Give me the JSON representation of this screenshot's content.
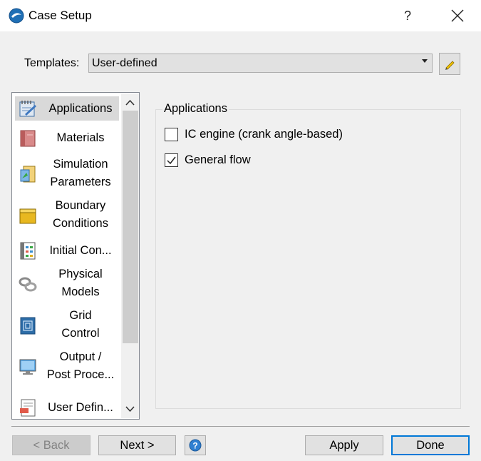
{
  "window": {
    "title": "Case Setup",
    "help_label": "?",
    "icons": {
      "app": "app-logo-icon",
      "close": "close-icon"
    }
  },
  "templates": {
    "label": "Templates:",
    "selected": "User-defined",
    "edit_icon": "pencil-icon"
  },
  "nav": {
    "items": [
      {
        "label": "Applications",
        "icon": "applications-icon",
        "selected": true
      },
      {
        "label": "Materials",
        "icon": "materials-icon"
      },
      {
        "label": "Simulation Parameters",
        "line1": "Simulation",
        "line2": "Parameters",
        "icon": "simulation-parameters-icon"
      },
      {
        "label": "Boundary Conditions",
        "line1": "Boundary",
        "line2": "Conditions",
        "icon": "boundary-conditions-icon"
      },
      {
        "label": "Initial Con...",
        "icon": "initial-conditions-icon"
      },
      {
        "label": "Physical Models",
        "line1": "Physical",
        "line2": "Models",
        "icon": "physical-models-icon"
      },
      {
        "label": "Grid Control",
        "line1": "Grid",
        "line2": "Control",
        "icon": "grid-control-icon"
      },
      {
        "label": "Output / Post Proce...",
        "line1": "Output /",
        "line2": "Post Proce...",
        "icon": "output-icon"
      },
      {
        "label": "User Defin...",
        "icon": "user-defined-icon"
      }
    ]
  },
  "applications": {
    "group_title": "Applications",
    "options": [
      {
        "label": "IC engine (crank angle-based)",
        "checked": false
      },
      {
        "label": "General flow",
        "checked": true
      }
    ]
  },
  "footer": {
    "back": "< Back",
    "next": "Next >",
    "help_icon": "help-circle-icon",
    "apply": "Apply",
    "done": "Done"
  },
  "colors": {
    "background": "#f0f0f0",
    "accent": "#0078d7",
    "selection": "#d9d9d9"
  }
}
